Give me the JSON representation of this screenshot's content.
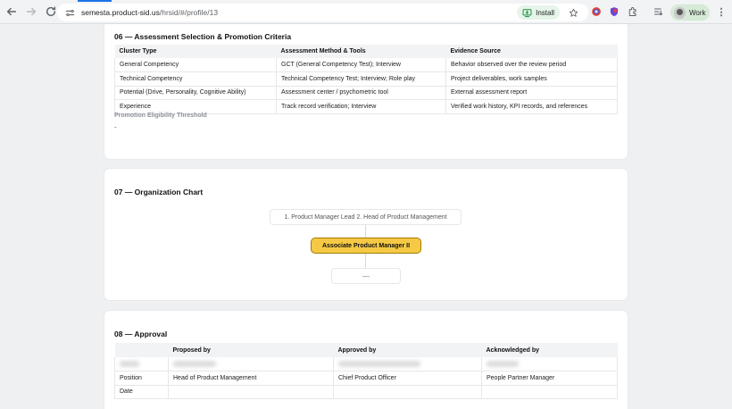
{
  "browser": {
    "url_domain": "semesta.product-sid.us",
    "url_path": "/hrsid/#/profile/13",
    "install_label": "Install",
    "profile_label": "Work"
  },
  "section06": {
    "title": "06 — Assessment Selection & Promotion Criteria",
    "headers": [
      "Cluster Type",
      "Assessment Method & Tools",
      "Evidence Source"
    ],
    "rows": [
      [
        "General Competency",
        "GCT (General Competency Test); Interview",
        "Behavior observed over the review period"
      ],
      [
        "Technical Competency",
        "Technical Competency Test; Interview; Role play",
        "Project deliverables, work samples"
      ],
      [
        "Potential (Drive, Personality, Cognitive Ability)",
        "Assessment center / psychometric tool",
        "External assessment report"
      ],
      [
        "Experience",
        "Track record verification; Interview",
        "Verified work history, KPI records, and references"
      ]
    ],
    "threshold_label": "Promotion Eligibility Threshold",
    "threshold_value": "-"
  },
  "section07": {
    "title": "07 — Organization Chart",
    "superior": "1. Product Manager Lead 2. Head of Product Management",
    "current": "Associate Product Manager II",
    "subordinate": "—"
  },
  "section08": {
    "title": "08 — Approval",
    "headers": [
      "",
      "Proposed by",
      "Approved by",
      "Acknowledged by"
    ],
    "position_label": "Position",
    "date_label": "Date",
    "positions": [
      "Head of Product Management",
      "Chief Product Officer",
      "People Partner Manager"
    ]
  }
}
